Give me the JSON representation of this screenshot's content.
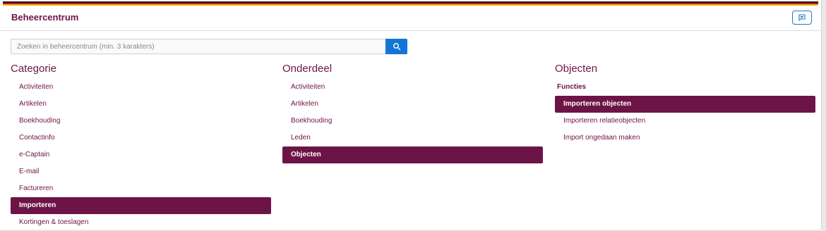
{
  "colors": {
    "brand": "#6d1447",
    "accent": "#1176d4",
    "flag": [
      "#1a1a1a",
      "#c8102e",
      "#f3c000"
    ]
  },
  "header": {
    "title": "Beheercentrum",
    "chat_icon": "message-square-icon"
  },
  "search": {
    "placeholder": "Zoeken in beheercentrum (min. 3 karakters)",
    "value": "",
    "icon": "search-icon"
  },
  "categorie": {
    "heading": "Categorie",
    "items": [
      {
        "label": "Activiteiten",
        "active": false
      },
      {
        "label": "Artikelen",
        "active": false
      },
      {
        "label": "Boekhouding",
        "active": false
      },
      {
        "label": "Contactinfo",
        "active": false
      },
      {
        "label": "e-Captain",
        "active": false
      },
      {
        "label": "E-mail",
        "active": false
      },
      {
        "label": "Factureren",
        "active": false
      },
      {
        "label": "Importeren",
        "active": true
      },
      {
        "label": "Kortingen & toeslagen",
        "active": false
      }
    ]
  },
  "onderdeel": {
    "heading": "Onderdeel",
    "items": [
      {
        "label": "Activiteiten",
        "active": false
      },
      {
        "label": "Artikelen",
        "active": false
      },
      {
        "label": "Boekhouding",
        "active": false
      },
      {
        "label": "Leden",
        "active": false
      },
      {
        "label": "Objecten",
        "active": true
      }
    ]
  },
  "objecten": {
    "heading": "Objecten",
    "group_label": "Functies",
    "items": [
      {
        "label": "Importeren objecten",
        "active": true
      },
      {
        "label": "Importeren relatieobjecten",
        "active": false
      },
      {
        "label": "Import ongedaan maken",
        "active": false
      }
    ]
  }
}
